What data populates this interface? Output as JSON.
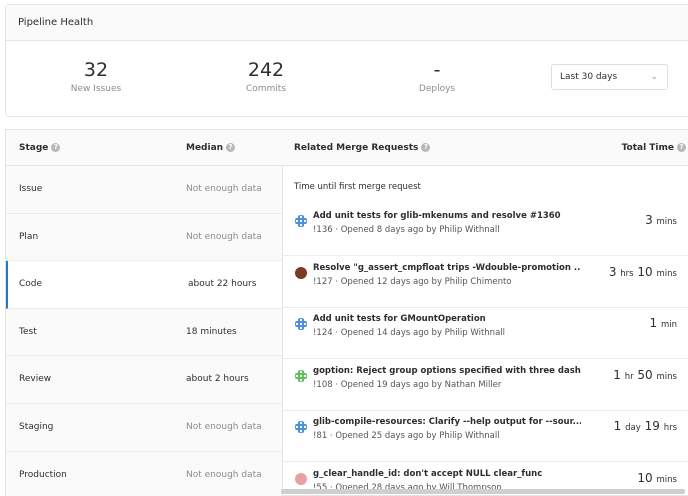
{
  "panel": {
    "title": "Pipeline Health",
    "stats": [
      {
        "value": "32",
        "label": "New Issues"
      },
      {
        "value": "242",
        "label": "Commits"
      },
      {
        "value": "-",
        "label": "Deploys"
      }
    ],
    "range_dropdown": {
      "selected": "Last 30 days",
      "icon": "chevron-down-icon"
    }
  },
  "table": {
    "headers": {
      "stage": "Stage",
      "median": "Median",
      "related": "Related Merge Requests",
      "total": "Total Time"
    },
    "stages": [
      {
        "name": "Issue",
        "median": "Not enough data",
        "muted": true
      },
      {
        "name": "Plan",
        "median": "Not enough data",
        "muted": true
      },
      {
        "name": "Code",
        "median": "about 22 hours",
        "muted": false,
        "active": true
      },
      {
        "name": "Test",
        "median": "18 minutes",
        "muted": false
      },
      {
        "name": "Review",
        "median": "about 2 hours",
        "muted": false
      },
      {
        "name": "Staging",
        "median": "Not enough data",
        "muted": true
      },
      {
        "name": "Production",
        "median": "Not enough data",
        "muted": true
      }
    ],
    "stage_description": "Time until first merge request",
    "merge_requests": [
      {
        "title": "Add unit tests for glib-mkenums and resolve #1360",
        "meta": "!136 · Opened 8 days ago by Philip Withnall",
        "time": [
          [
            "3",
            "mins"
          ]
        ],
        "avatar": "blue-pattern",
        "avatar_color": "#4a8fd6"
      },
      {
        "title": "Resolve \"g_assert_cmpfloat trips -Wdouble-promotion ...",
        "meta": "!127 · Opened 12 days ago by Philip Chimento",
        "time": [
          [
            "3",
            "hrs"
          ],
          [
            "10",
            "mins"
          ]
        ],
        "avatar": "photo",
        "avatar_color": "#7a3a24"
      },
      {
        "title": "Add unit tests for GMountOperation",
        "meta": "!124 · Opened 14 days ago by Philip Withnall",
        "time": [
          [
            "1",
            "min"
          ]
        ],
        "avatar": "blue-pattern",
        "avatar_color": "#4a8fd6"
      },
      {
        "title": "goption: Reject group options specified with three dashes",
        "meta": "!108 · Opened 19 days ago by Nathan Miller",
        "time": [
          [
            "1",
            "hr"
          ],
          [
            "50",
            "mins"
          ]
        ],
        "avatar": "green-pattern",
        "avatar_color": "#5fbf5a"
      },
      {
        "title": "glib-compile-resources: Clarify --help output for --sour...",
        "meta": "!81 · Opened 25 days ago by Philip Withnall",
        "time": [
          [
            "1",
            "day"
          ],
          [
            "19",
            "hrs"
          ]
        ],
        "avatar": "blue-pattern",
        "avatar_color": "#4a8fd6"
      },
      {
        "title": "g_clear_handle_id: don't accept NULL clear_func",
        "meta": "!55 · Opened 28 days ago by Will Thompson",
        "time": [
          [
            "10",
            "mins"
          ]
        ],
        "avatar": "photo",
        "avatar_color": "#e8a0a0"
      }
    ]
  }
}
